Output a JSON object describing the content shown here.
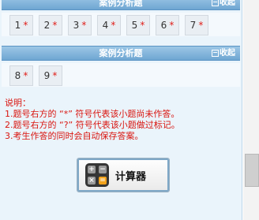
{
  "sections": [
    {
      "title": "案例分析题",
      "collapse_label": "收起",
      "questions": [
        {
          "num": "1",
          "mark": "*"
        },
        {
          "num": "2",
          "mark": "*"
        },
        {
          "num": "3",
          "mark": "*"
        },
        {
          "num": "4",
          "mark": "*"
        },
        {
          "num": "5",
          "mark": "*"
        },
        {
          "num": "6",
          "mark": "*"
        },
        {
          "num": "7",
          "mark": "*"
        }
      ]
    },
    {
      "title": "案例分析题",
      "collapse_label": "收起",
      "questions": [
        {
          "num": "8",
          "mark": "*"
        },
        {
          "num": "9",
          "mark": "*"
        }
      ]
    }
  ],
  "instructions": {
    "heading": "说明：",
    "lines": [
      "1.题号右方的 “*” 符号代表该小题尚未作答。",
      "2.题号右方的 “?” 符号代表该小题做过标记。",
      "3.考生作答的同时会自动保存答案。"
    ]
  },
  "calculator": {
    "label": "计算器",
    "icon": "calculator-icon",
    "key_colors": {
      "plus": "#9a9a9a",
      "minus": "#9a9a9a",
      "times": "#9a9a9a",
      "equals": "#f2a21b"
    }
  }
}
